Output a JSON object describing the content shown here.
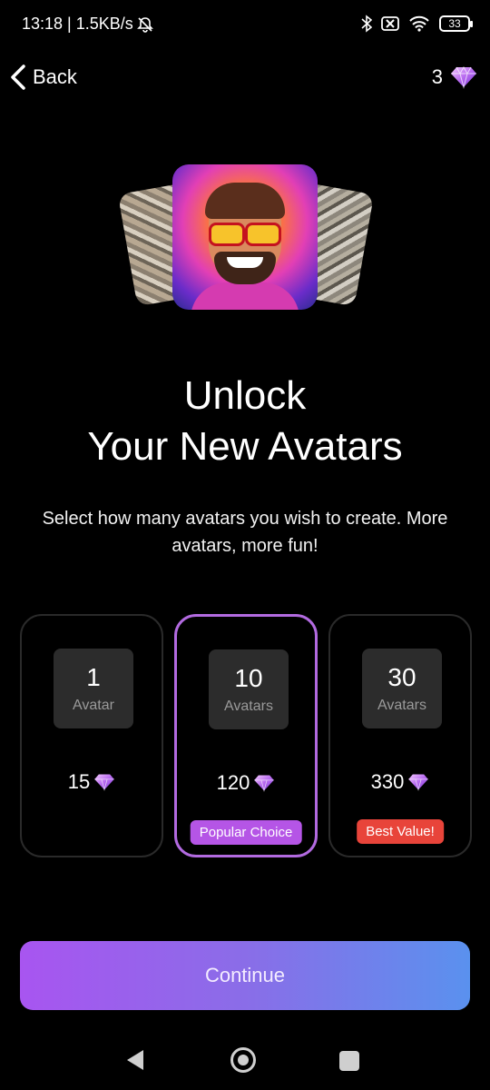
{
  "status_bar": {
    "time_speed": "13:18 | 1.5KB/s",
    "battery": "33"
  },
  "header": {
    "back_label": "Back",
    "gem_count": "3"
  },
  "title_line1": "Unlock",
  "title_line2": "Your New Avatars",
  "subtitle": "Select how many avatars you wish to create. More avatars, more fun!",
  "plans": [
    {
      "count": "1",
      "unit": "Avatar",
      "price": "15",
      "badge": "",
      "selected": false
    },
    {
      "count": "10",
      "unit": "Avatars",
      "price": "120",
      "badge": "Popular Choice",
      "badge_color": "#b555e6",
      "selected": true
    },
    {
      "count": "30",
      "unit": "Avatars",
      "price": "330",
      "badge": "Best Value!",
      "badge_color": "#e8443a",
      "selected": false
    }
  ],
  "continue_label": "Continue",
  "colors": {
    "accent": "#b26ae0",
    "button_gradient_start": "#a855f0",
    "button_gradient_end": "#5a91ee",
    "background": "#000000"
  },
  "icons": [
    "bell-off-icon",
    "bluetooth-icon",
    "sim-off-icon",
    "wifi-icon",
    "battery-icon",
    "chevron-left-icon",
    "gem-icon",
    "nav-back-icon",
    "nav-home-icon",
    "nav-recents-icon"
  ]
}
